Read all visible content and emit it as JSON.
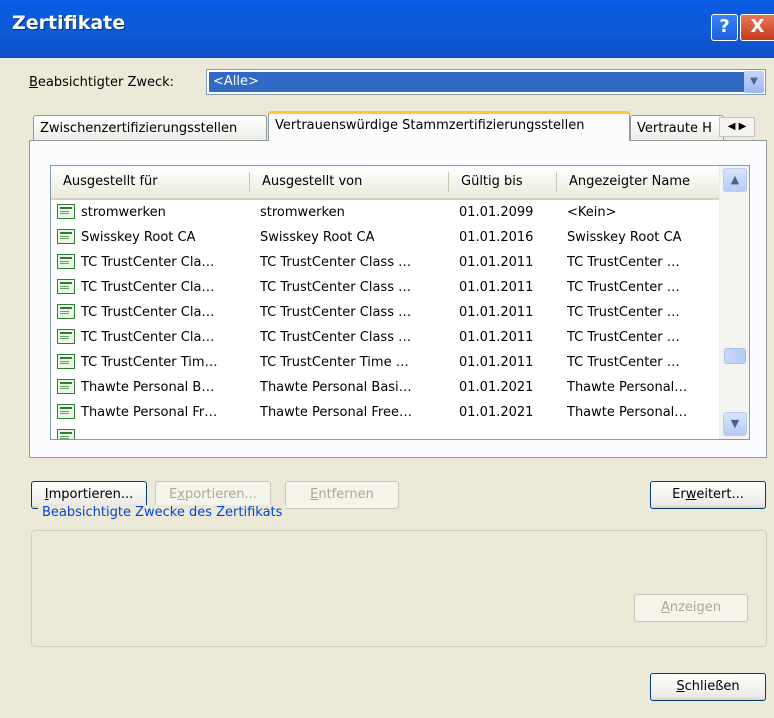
{
  "window": {
    "title": "Zertifikate",
    "help_label": "?",
    "close_label": "X"
  },
  "purpose": {
    "label_prefix": "B",
    "label_rest": "eabsichtigter Zweck:",
    "value": "<Alle>"
  },
  "tabs": [
    {
      "label": "Zwischenzertifizierungsstellen"
    },
    {
      "label": "Vertrauenswürdige Stammzertifizierungsstellen"
    },
    {
      "label": "Vertraute H"
    }
  ],
  "table": {
    "columns": [
      "Ausgestellt für",
      "Ausgestellt von",
      "Gültig bis",
      "Angezeigter Name"
    ],
    "rows": [
      [
        "stromwerken",
        "stromwerken",
        "01.01.2099",
        "<Kein>"
      ],
      [
        "Swisskey Root CA",
        "Swisskey Root CA",
        "01.01.2016",
        "Swisskey Root CA"
      ],
      [
        "TC TrustCenter Cla…",
        "TC TrustCenter Class …",
        "01.01.2011",
        "TC TrustCenter …"
      ],
      [
        "TC TrustCenter Cla…",
        "TC TrustCenter Class …",
        "01.01.2011",
        "TC TrustCenter …"
      ],
      [
        "TC TrustCenter Cla…",
        "TC TrustCenter Class …",
        "01.01.2011",
        "TC TrustCenter …"
      ],
      [
        "TC TrustCenter Cla…",
        "TC TrustCenter Class …",
        "01.01.2011",
        "TC TrustCenter …"
      ],
      [
        "TC TrustCenter Tim…",
        "TC TrustCenter Time …",
        "01.01.2011",
        "TC TrustCenter …"
      ],
      [
        "Thawte Personal B…",
        "Thawte Personal Basi…",
        "01.01.2021",
        "Thawte Personal…"
      ],
      [
        "Thawte Personal Fr…",
        "Thawte Personal Free…",
        "01.01.2021",
        "Thawte Personal…"
      ]
    ]
  },
  "buttons": {
    "import": {
      "u": "I",
      "rest": "mportieren..."
    },
    "export": {
      "pre": "E",
      "u": "x",
      "rest": "portieren..."
    },
    "remove": {
      "u": "E",
      "rest": "ntfernen"
    },
    "advanced": {
      "pre": "Er",
      "u": "w",
      "rest": "eitert..."
    },
    "view": {
      "u": "A",
      "rest": "nzeigen"
    },
    "close": {
      "u": "S",
      "rest": "chließen"
    }
  },
  "purposes_group": {
    "label": "Beabsichtigte Zwecke des Zertifikats"
  }
}
